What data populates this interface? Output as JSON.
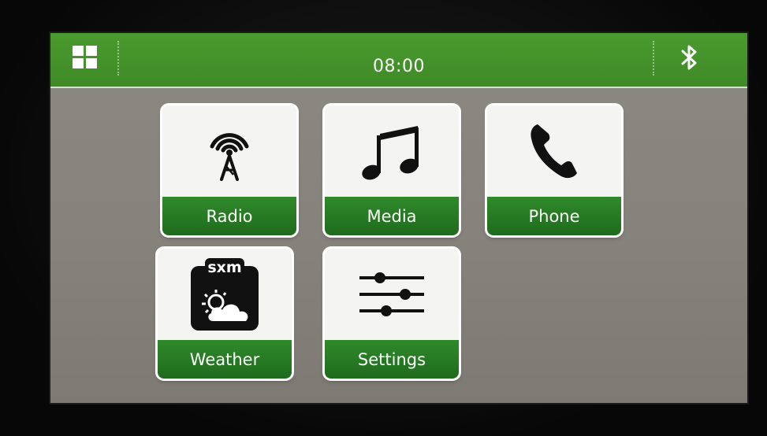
{
  "header": {
    "time": "08:00",
    "menu_icon": "apps-grid-icon",
    "bluetooth_icon": "bluetooth-icon"
  },
  "tiles": [
    {
      "label": "Radio",
      "icon": "radio-tower-icon"
    },
    {
      "label": "Media",
      "icon": "music-note-icon"
    },
    {
      "label": "Phone",
      "icon": "phone-handset-icon"
    },
    {
      "label": "Weather",
      "icon": "sxm-weather-icon",
      "badge": "sxm"
    },
    {
      "label": "Settings",
      "icon": "sliders-icon"
    }
  ],
  "colors": {
    "header_green": "#4a9b2f",
    "label_green": "#2f8a2a",
    "screen_bg": "#8c8882",
    "tile_bg": "#f4f4f2"
  }
}
